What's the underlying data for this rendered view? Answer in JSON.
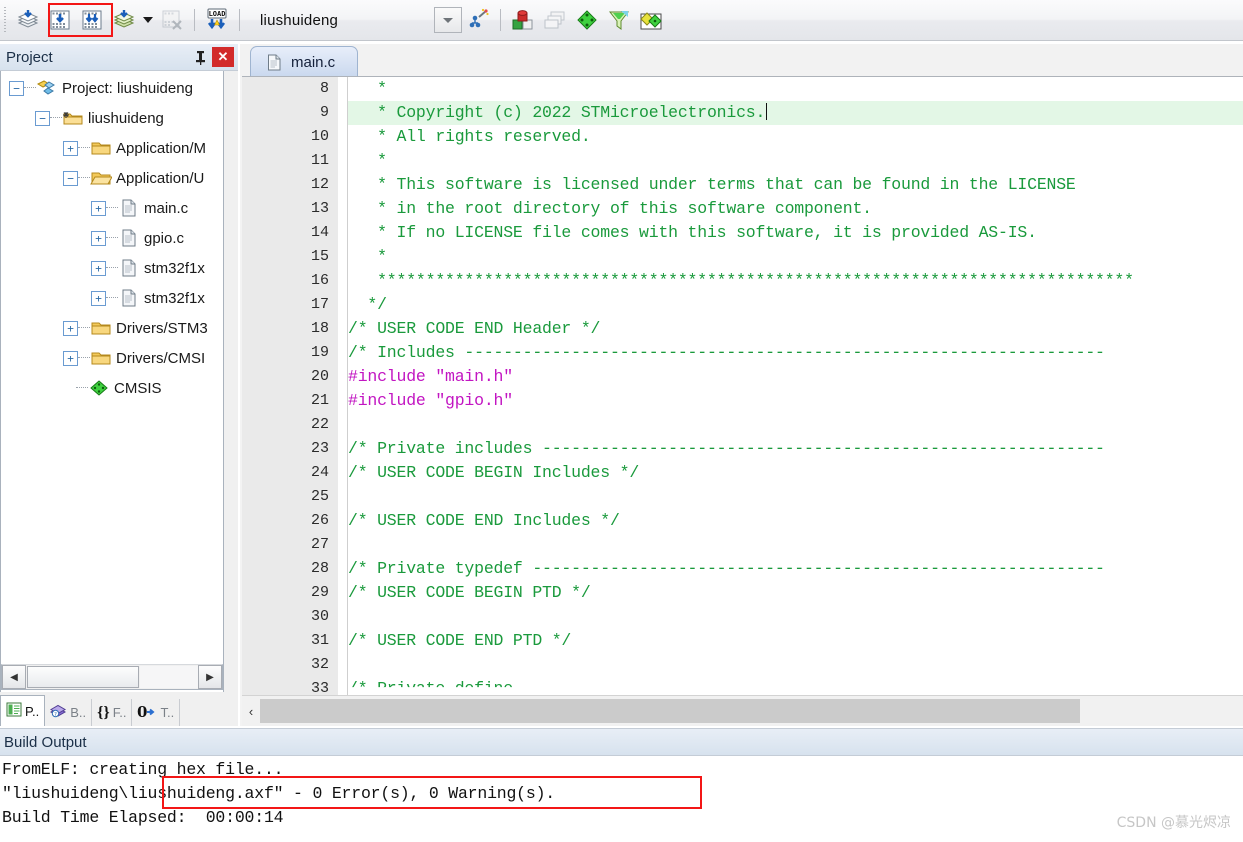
{
  "toolbar": {
    "buttons": [
      {
        "name": "translate-icon",
        "glyph": "stack-blue"
      },
      {
        "name": "build-icon",
        "glyph": "build"
      },
      {
        "name": "rebuild-icon",
        "glyph": "rebuild"
      },
      {
        "name": "batch-build-icon",
        "glyph": "stack-blue"
      },
      {
        "name": "batch-build-dropdown-icon",
        "glyph": "caret"
      },
      {
        "name": "stop-build-icon",
        "glyph": "stopbuild"
      },
      {
        "name": "download-icon",
        "glyph": "load"
      }
    ],
    "project_name": "liushuideng",
    "right_buttons": [
      {
        "name": "target-options-icon",
        "glyph": "wand"
      },
      {
        "name": "manage-runtime-icon",
        "glyph": "cubes"
      },
      {
        "name": "multiproject-icon",
        "glyph": "windows"
      },
      {
        "name": "components-icon",
        "glyph": "green-diamond"
      },
      {
        "name": "packs-icon",
        "glyph": "funnel"
      },
      {
        "name": "pack-installer-icon",
        "glyph": "pack"
      }
    ],
    "highlight_color": "#f31616"
  },
  "project_panel": {
    "title": "Project",
    "pin_glyph": "丬",
    "close_glyph": "✕",
    "tree": [
      {
        "label": "Project: liushuideng",
        "indent": 0,
        "expander": "-",
        "icon": "project-icon"
      },
      {
        "label": "liushuideng",
        "indent": 1,
        "expander": "-",
        "icon": "target-folder-icon"
      },
      {
        "label": "Application/M",
        "indent": 2,
        "expander": "+",
        "icon": "folder-closed-icon"
      },
      {
        "label": "Application/U",
        "indent": 2,
        "expander": "-",
        "icon": "folder-open-icon"
      },
      {
        "label": "main.c",
        "indent": 3,
        "expander": "+",
        "icon": "c-file-icon"
      },
      {
        "label": "gpio.c",
        "indent": 3,
        "expander": "+",
        "icon": "c-file-icon"
      },
      {
        "label": "stm32f1x",
        "indent": 3,
        "expander": "+",
        "icon": "c-file-icon"
      },
      {
        "label": "stm32f1x",
        "indent": 3,
        "expander": "+",
        "icon": "c-file-icon"
      },
      {
        "label": "Drivers/STM3",
        "indent": 2,
        "expander": "+",
        "icon": "folder-closed-icon"
      },
      {
        "label": "Drivers/CMSI",
        "indent": 2,
        "expander": "+",
        "icon": "folder-closed-icon"
      },
      {
        "label": "CMSIS",
        "indent": 2,
        "expander": "",
        "icon": "green-diamond-icon"
      }
    ],
    "hscroll": {
      "left_glyph": "◀",
      "right_glyph": "▶"
    },
    "tabs": [
      {
        "label": "P..",
        "icon": "project-tab-icon",
        "active": true
      },
      {
        "label": "B..",
        "icon": "books-tab-icon",
        "active": false
      },
      {
        "label": "F..",
        "icon": "functions-tab-icon",
        "active": false
      },
      {
        "label": "T..",
        "icon": "templates-tab-icon",
        "active": false
      }
    ]
  },
  "editor": {
    "tab": {
      "label": "main.c",
      "icon": "c-file-icon"
    },
    "first_line_number": 8,
    "lines": [
      {
        "n": 8,
        "text": "   *",
        "kind": "cmt",
        "hl": false
      },
      {
        "n": 9,
        "text": "   * Copyright (c) 2022 STMicroelectronics.",
        "kind": "cmt",
        "hl": true,
        "caret": true
      },
      {
        "n": 10,
        "text": "   * All rights reserved.",
        "kind": "cmt",
        "hl": false
      },
      {
        "n": 11,
        "text": "   *",
        "kind": "cmt",
        "hl": false
      },
      {
        "n": 12,
        "text": "   * This software is licensed under terms that can be found in the LICENSE",
        "kind": "cmt",
        "hl": false
      },
      {
        "n": 13,
        "text": "   * in the root directory of this software component.",
        "kind": "cmt",
        "hl": false
      },
      {
        "n": 14,
        "text": "   * If no LICENSE file comes with this software, it is provided AS-IS.",
        "kind": "cmt",
        "hl": false
      },
      {
        "n": 15,
        "text": "   *",
        "kind": "cmt",
        "hl": false
      },
      {
        "n": 16,
        "text": "   ******************************************************************************",
        "kind": "cmt",
        "hl": false
      },
      {
        "n": 17,
        "text": "  */",
        "kind": "cmt",
        "hl": false
      },
      {
        "n": 18,
        "text": "/* USER CODE END Header */",
        "kind": "cmt",
        "hl": false
      },
      {
        "n": 19,
        "text": "/* Includes ------------------------------------------------------------------",
        "kind": "cmt",
        "hl": false
      },
      {
        "n": 20,
        "text": "#include \"main.h\"",
        "kind": "pre",
        "hl": false
      },
      {
        "n": 21,
        "text": "#include \"gpio.h\"",
        "kind": "pre",
        "hl": false
      },
      {
        "n": 22,
        "text": "",
        "kind": "cmt",
        "hl": false
      },
      {
        "n": 23,
        "text": "/* Private includes ----------------------------------------------------------",
        "kind": "cmt",
        "hl": false
      },
      {
        "n": 24,
        "text": "/* USER CODE BEGIN Includes */",
        "kind": "cmt",
        "hl": false
      },
      {
        "n": 25,
        "text": "",
        "kind": "cmt",
        "hl": false
      },
      {
        "n": 26,
        "text": "/* USER CODE END Includes */",
        "kind": "cmt",
        "hl": false
      },
      {
        "n": 27,
        "text": "",
        "kind": "cmt",
        "hl": false
      },
      {
        "n": 28,
        "text": "/* Private typedef -----------------------------------------------------------",
        "kind": "cmt",
        "hl": false
      },
      {
        "n": 29,
        "text": "/* USER CODE BEGIN PTD */",
        "kind": "cmt",
        "hl": false
      },
      {
        "n": 30,
        "text": "",
        "kind": "cmt",
        "hl": false
      },
      {
        "n": 31,
        "text": "/* USER CODE END PTD */",
        "kind": "cmt",
        "hl": false
      },
      {
        "n": 32,
        "text": "",
        "kind": "cmt",
        "hl": false
      },
      {
        "n": 33,
        "text": "/* Private define",
        "kind": "cmt",
        "hl": false
      }
    ],
    "hscroll": {
      "left_glyph": "‹"
    },
    "colors": {
      "comment": "#1a9a3c",
      "preprocessor": "#c215c2",
      "current_line_bg": "#e3f7e6"
    }
  },
  "build_output": {
    "title": "Build Output",
    "lines": [
      "FromELF: creating hex file...",
      "\"liushuideng\\liushuideng.axf\" - 0 Error(s), 0 Warning(s).",
      "Build Time Elapsed:  00:00:14"
    ],
    "highlight_color": "#f31616"
  },
  "watermark": "CSDN @慕光烬凉"
}
